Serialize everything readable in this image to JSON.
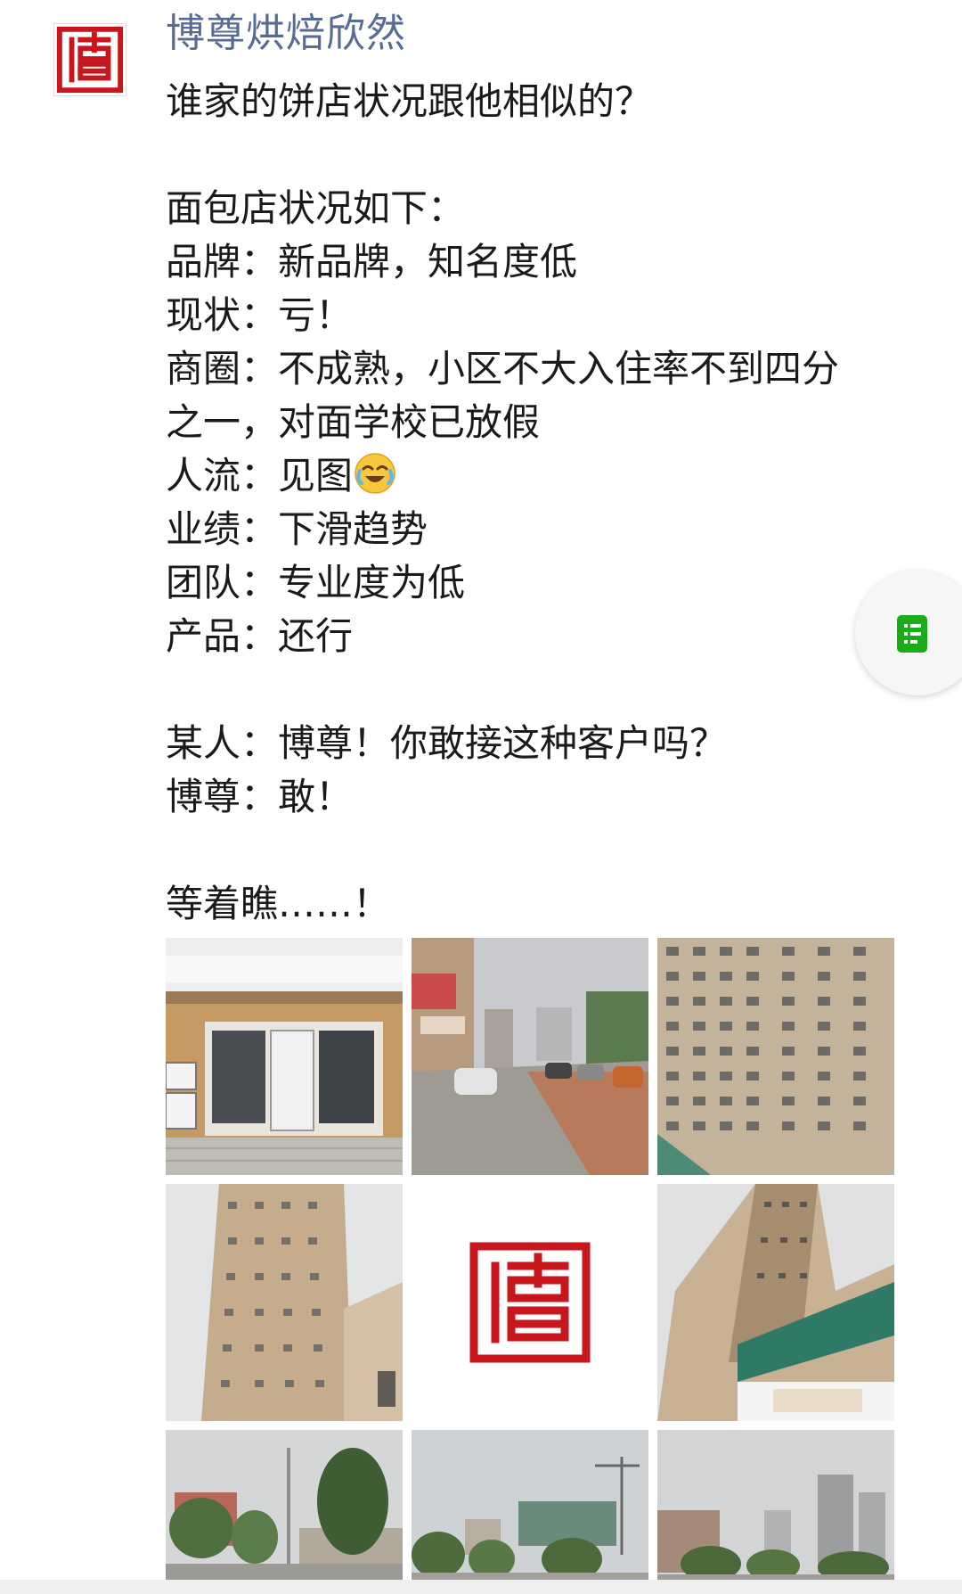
{
  "post": {
    "author": "博尊烘焙欣然",
    "lines": [
      "谁家的饼店状况跟他相似的？",
      "",
      "面包店状况如下：",
      "品牌：新品牌，知名度低",
      "现状：亏！",
      "商圈：不成熟，小区不大入住率不到四分",
      "之一，对面学校已放假",
      "人流：见图",
      "业绩：下滑趋势",
      "团队：专业度为低",
      "产品：还行",
      "",
      "某人：博尊！你敢接这种客户吗？",
      "博尊：敢！",
      "",
      "等着瞧……！"
    ],
    "emoji": "crying-laughing-emoji"
  },
  "photos": [
    {
      "name": "photo-storefront",
      "subject": "storefront"
    },
    {
      "name": "photo-street",
      "subject": "street"
    },
    {
      "name": "photo-apartment",
      "subject": "apartment"
    },
    {
      "name": "photo-tower",
      "subject": "tower"
    },
    {
      "name": "photo-logo",
      "subject": "logo"
    },
    {
      "name": "photo-building-sign",
      "subject": "building"
    },
    {
      "name": "photo-trees",
      "subject": "trees"
    },
    {
      "name": "photo-skyline",
      "subject": "skyline"
    },
    {
      "name": "photo-distant-towers",
      "subject": "towers"
    }
  ],
  "icons": {
    "avatar": "seal-logo-icon",
    "float": "document-icon"
  },
  "colors": {
    "author": "#576b95",
    "text": "#1a1a1a",
    "seal": "#c8161d",
    "float_icon": "#1aad19"
  }
}
